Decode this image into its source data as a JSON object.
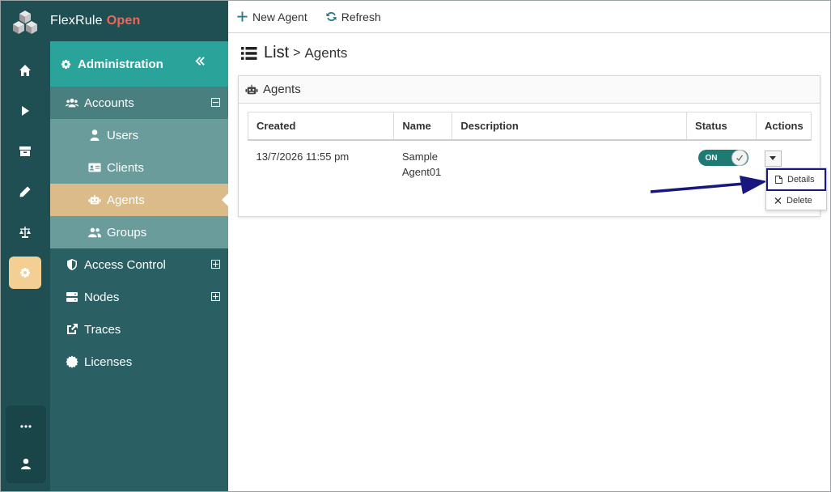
{
  "brand": {
    "name": "FlexRule",
    "accent": "Open"
  },
  "rail": {
    "items": [
      "home-icon",
      "play-icon",
      "archive-icon",
      "pencil-icon",
      "balance-scale-icon",
      "gear-icon"
    ],
    "bottom": [
      "more-icon",
      "user-icon"
    ],
    "active": "gear-icon"
  },
  "sidebar": {
    "header": "Administration",
    "items": [
      {
        "label": "Accounts",
        "icon": "users-icon",
        "expanded": true
      },
      {
        "label": "Users",
        "icon": "user-icon"
      },
      {
        "label": "Clients",
        "icon": "id-card-icon"
      },
      {
        "label": "Agents",
        "icon": "robot-icon",
        "selected": true
      },
      {
        "label": "Groups",
        "icon": "group-icon"
      },
      {
        "label": "Access Control",
        "icon": "shield-icon",
        "expanded": false
      },
      {
        "label": "Nodes",
        "icon": "server-icon",
        "expanded": false
      },
      {
        "label": "Traces",
        "icon": "external-link-icon"
      },
      {
        "label": "Licenses",
        "icon": "certificate-icon"
      }
    ]
  },
  "toolbar": {
    "new_agent": "New Agent",
    "refresh": "Refresh"
  },
  "breadcrumb": {
    "root": "List",
    "separator": ">",
    "current": "Agents"
  },
  "panel": {
    "title": "Agents"
  },
  "table": {
    "headers": [
      "Created",
      "Name",
      "Description",
      "Status",
      "Actions"
    ],
    "rows": [
      {
        "created": "13/7/2026 11:55 pm",
        "name_line1": "Sample",
        "name_line2": "Agent01",
        "description": "",
        "status": "ON"
      }
    ]
  },
  "actions_menu": {
    "details": "Details",
    "delete": "Delete"
  },
  "colors": {
    "rail": "#1f4f52",
    "header_accent": "#2aa39a",
    "selected": "#dcbb8a",
    "brand_accent": "#f0665a",
    "toggle_on": "#1e7a73",
    "highlight": "#17177f"
  }
}
